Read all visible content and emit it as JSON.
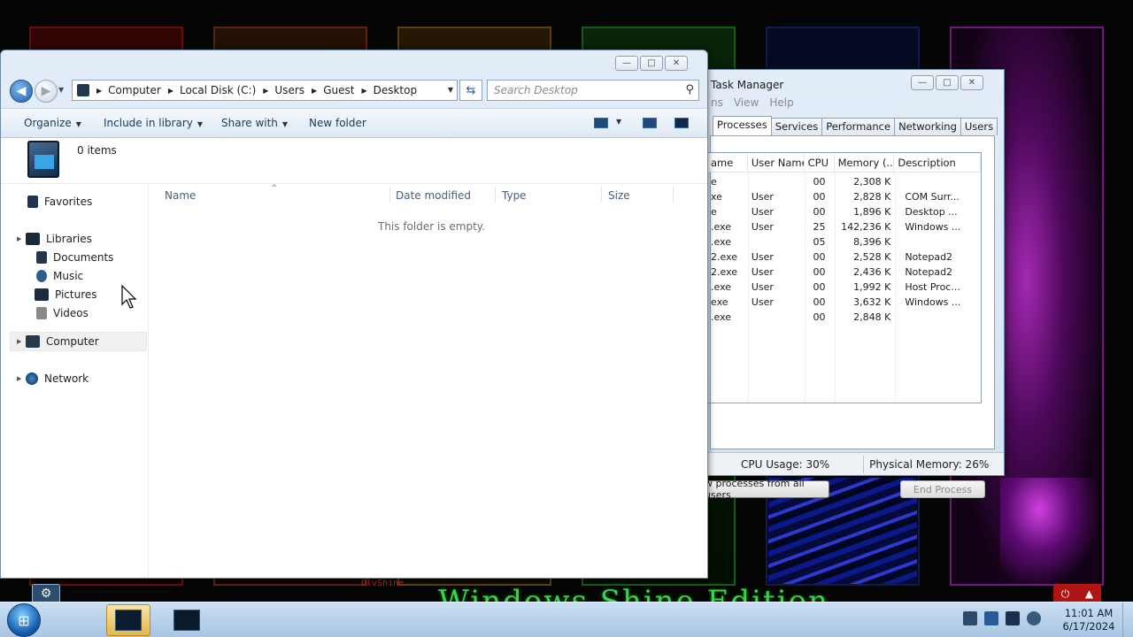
{
  "explorer": {
    "breadcrumb": [
      "Computer",
      "Local Disk (C:)",
      "Users",
      "Guest",
      "Desktop"
    ],
    "search_placeholder": "Search Desktop",
    "commands": {
      "organize": "Organize",
      "include": "Include in library",
      "share": "Share with",
      "new_folder": "New folder"
    },
    "item_count": "0 items",
    "nav": {
      "favorites": "Favorites",
      "libraries": "Libraries",
      "documents": "Documents",
      "music": "Music",
      "pictures": "Pictures",
      "videos": "Videos",
      "computer": "Computer",
      "network": "Network"
    },
    "columns": [
      "Name",
      "Date modified",
      "Type",
      "Size"
    ],
    "empty_message": "This folder is empty."
  },
  "taskmgr": {
    "title": "Task Manager",
    "menu": [
      "ns",
      "View",
      "Help"
    ],
    "tabs": [
      "Processes",
      "Services",
      "Performance",
      "Networking",
      "Users"
    ],
    "columns": [
      "ame",
      "User Name",
      "CPU",
      "Memory (...",
      "Description"
    ],
    "rows": [
      {
        "name": "e",
        "user": "",
        "cpu": "00",
        "mem": "2,308 K",
        "desc": ""
      },
      {
        "name": "xe",
        "user": "User",
        "cpu": "00",
        "mem": "2,828 K",
        "desc": "COM Surr..."
      },
      {
        "name": "e",
        "user": "User",
        "cpu": "00",
        "mem": "1,896 K",
        "desc": "Desktop ..."
      },
      {
        "name": ".exe",
        "user": "User",
        "cpu": "25",
        "mem": "142,236 K",
        "desc": "Windows ..."
      },
      {
        "name": ".exe",
        "user": "",
        "cpu": "05",
        "mem": "8,396 K",
        "desc": ""
      },
      {
        "name": "2.exe",
        "user": "User",
        "cpu": "00",
        "mem": "2,528 K",
        "desc": "Notepad2"
      },
      {
        "name": "2.exe",
        "user": "User",
        "cpu": "00",
        "mem": "2,436 K",
        "desc": "Notepad2"
      },
      {
        "name": ".exe",
        "user": "User",
        "cpu": "00",
        "mem": "1,992 K",
        "desc": "Host Proc..."
      },
      {
        "name": "exe",
        "user": "User",
        "cpu": "00",
        "mem": "3,632 K",
        "desc": "Windows ..."
      },
      {
        "name": ".exe",
        "user": "",
        "cpu": "00",
        "mem": "2,848 K",
        "desc": ""
      }
    ],
    "show_all_label": "w processes from all users",
    "end_process_label": "End Process",
    "cpu_usage": "CPU Usage: 30%",
    "physical_memory": "Physical Memory: 26%"
  },
  "wallpaper": {
    "caption": "Windows Shine Edition",
    "signature": "OlvShine"
  },
  "taskbar": {
    "time": "11:01 AM",
    "date": "6/17/2024"
  },
  "colors": {
    "taskbar": "#b8d2ec",
    "explorer_chrome": "#dbe7f4",
    "wallpaper_accent": "#3bd14a"
  }
}
